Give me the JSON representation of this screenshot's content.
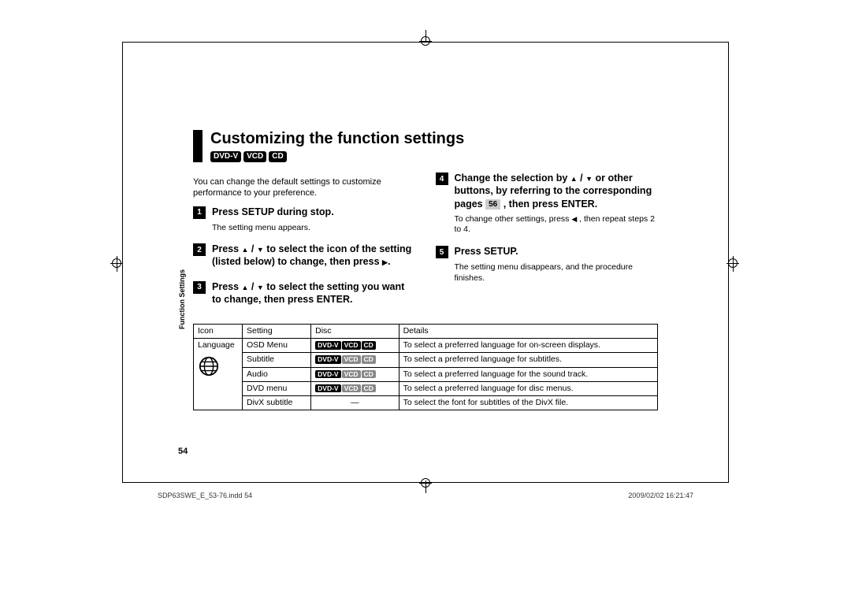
{
  "title": "Customizing the function settings",
  "disc_labels": [
    "DVD-V",
    "VCD",
    "CD"
  ],
  "intro": "You can change the default settings to customize performance to your preference.",
  "side_label": "Function Settings",
  "page_number": "54",
  "steps": [
    {
      "num": "1",
      "text": "Press SETUP during stop.",
      "sub": "The setting menu appears."
    },
    {
      "num": "2",
      "text_parts": [
        "Press ",
        " / ",
        " to select the icon of the setting (listed below) to change, then press ",
        "."
      ],
      "sub": null
    },
    {
      "num": "3",
      "text_parts": [
        "Press ",
        " / ",
        " to select the setting you want to change, then press ENTER."
      ],
      "sub": null
    },
    {
      "num": "4",
      "text_parts": [
        "Change the selection by ",
        " / ",
        " or other buttons, by referring to the corresponding pages ",
        " , then press ENTER."
      ],
      "sub_parts": [
        "To change other settings, press ",
        " , then repeat steps 2 to 4."
      ],
      "page_ref": "56"
    },
    {
      "num": "5",
      "text": "Press SETUP.",
      "sub": "The setting menu disappears, and the procedure finishes."
    }
  ],
  "table": {
    "headers": [
      "Icon",
      "Setting",
      "Disc",
      "Details"
    ],
    "icon_group": "Language",
    "rows": [
      {
        "setting": "OSD Menu",
        "disc": [
          "DVD-V",
          "VCD",
          "CD"
        ],
        "disc_active": [
          true,
          true,
          true
        ],
        "details": "To select a preferred language for on-screen displays."
      },
      {
        "setting": "Subtitle",
        "disc": [
          "DVD-V",
          "VCD",
          "CD"
        ],
        "disc_active": [
          true,
          false,
          false
        ],
        "details": "To select a preferred language for subtitles."
      },
      {
        "setting": "Audio",
        "disc": [
          "DVD-V",
          "VCD",
          "CD"
        ],
        "disc_active": [
          true,
          false,
          false
        ],
        "details": "To select a preferred language for the sound track."
      },
      {
        "setting": "DVD menu",
        "disc": [
          "DVD-V",
          "VCD",
          "CD"
        ],
        "disc_active": [
          true,
          false,
          false
        ],
        "details": "To select a preferred language for disc menus."
      },
      {
        "setting": "DivX subtitle",
        "disc_dash": "—",
        "details": "To select the font for subtitles of the DivX file."
      }
    ]
  },
  "footer": {
    "left": "SDP63SWE_E_53-76.indd   54",
    "right": "2009/02/02   16:21:47"
  }
}
